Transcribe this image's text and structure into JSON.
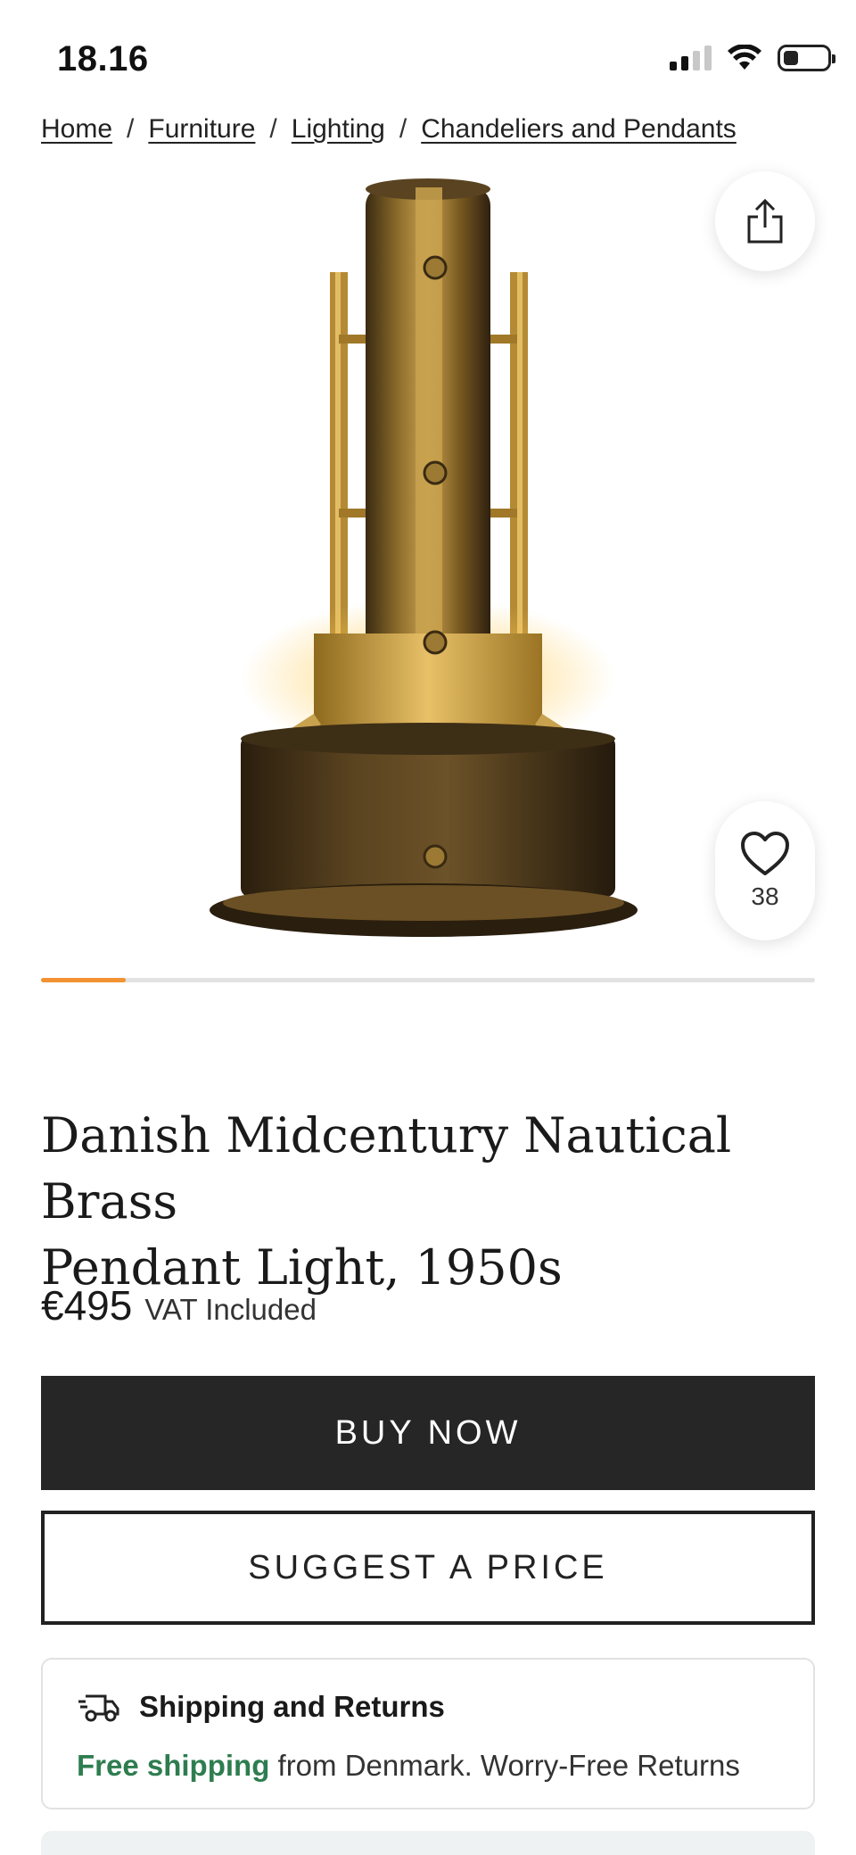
{
  "status_bar": {
    "time": "18.16",
    "icons": [
      "cellular-signal-icon",
      "wifi-icon",
      "battery-icon"
    ]
  },
  "breadcrumb": {
    "items": [
      "Home",
      "Furniture",
      "Lighting",
      "Chandeliers and Pendants"
    ],
    "separator": "/"
  },
  "gallery": {
    "image_subject": "brass pendant light",
    "progress_fraction": 0.11,
    "share_icon": "share-icon",
    "favorite_icon": "heart-icon",
    "favorite_count": "38"
  },
  "product": {
    "title_line1": "Danish Midcentury Nautical Brass",
    "title_line2": "Pendant Light, 1950s",
    "price": "€495",
    "vat_note": "VAT Included"
  },
  "actions": {
    "buy_now": "BUY NOW",
    "suggest_price": "SUGGEST A PRICE"
  },
  "shipping": {
    "icon": "delivery-truck-icon",
    "title": "Shipping and Returns",
    "free_label": "Free shipping",
    "detail": " from Denmark. Worry-Free Returns"
  },
  "colors": {
    "accent_progress": "#f29233",
    "primary_button": "#262626",
    "free_shipping": "#2e7d4f"
  }
}
